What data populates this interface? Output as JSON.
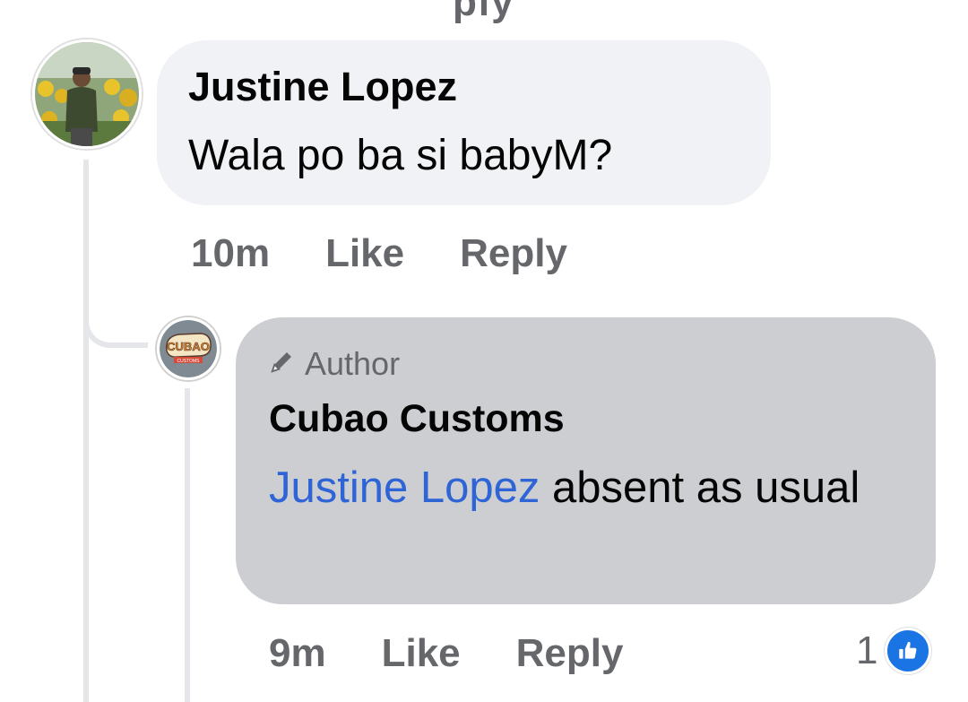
{
  "previous_comment_fragment": "ply",
  "comments": [
    {
      "author": "Justine Lopez",
      "text": "Wala po ba si babyM?",
      "time": "10m",
      "like_label": "Like",
      "reply_label": "Reply",
      "avatar_icon": "profile-photo-sunflower-field"
    }
  ],
  "reply": {
    "badge_icon": "pencil-icon",
    "badge_label": "Author",
    "author": "Cubao Customs",
    "mention": "Justine Lopez",
    "text": " absent as usual",
    "time": "9m",
    "like_label": "Like",
    "reply_label": "Reply",
    "reaction_count": "1",
    "reaction_icon": "like-thumb-icon",
    "avatar_icon": "cubao-customs-logo",
    "logo_text": "CUBAO",
    "logo_subtext": "CUSTOMS"
  },
  "colors": {
    "bubble_default": "#f0f2f5",
    "bubble_author": "#ccced2",
    "mention": "#2e64d6",
    "secondary_text": "#65676b",
    "like_blue": "#1b74e4"
  }
}
